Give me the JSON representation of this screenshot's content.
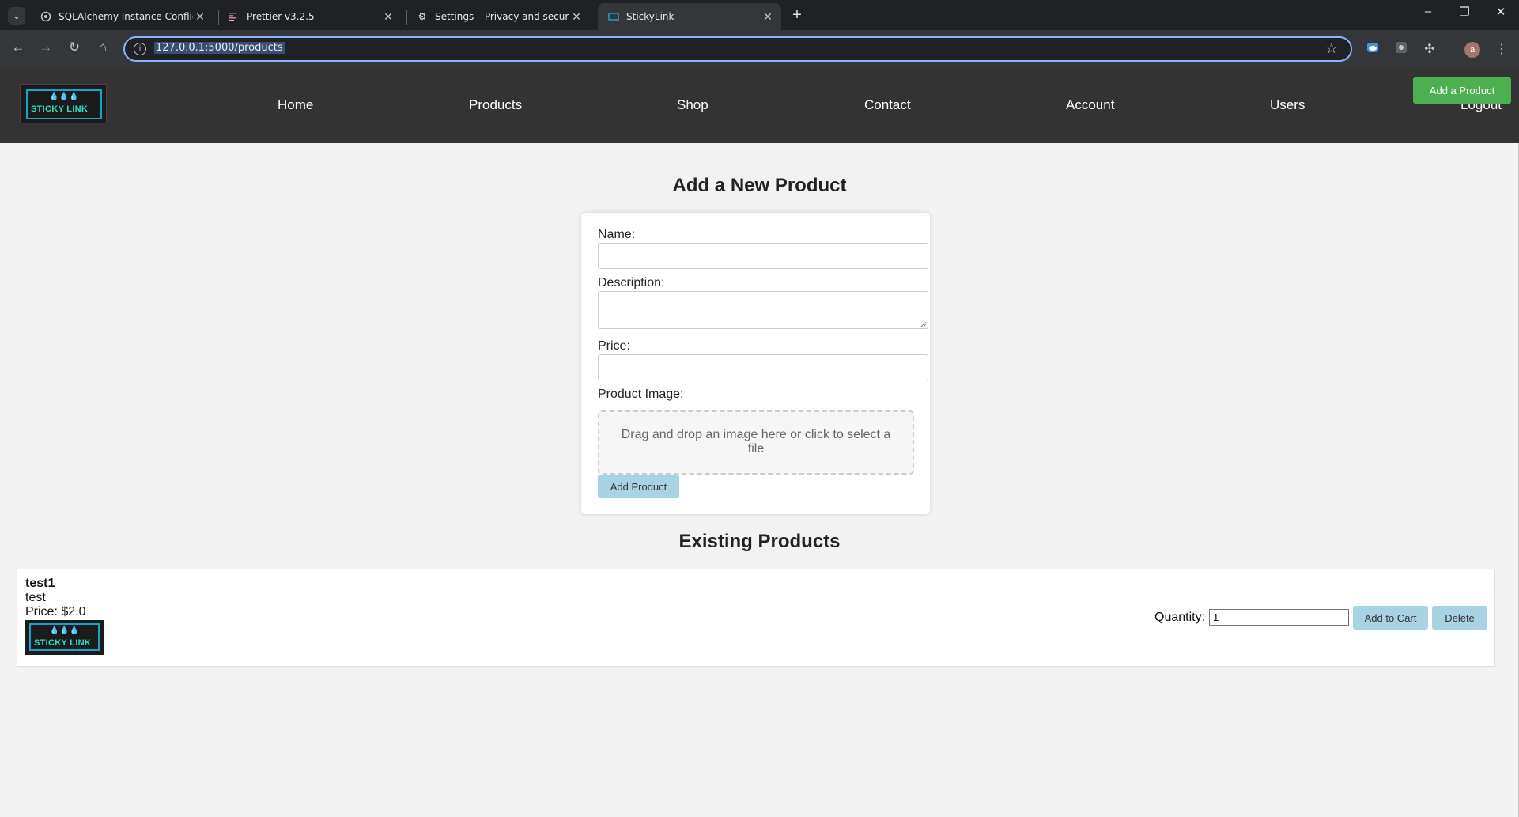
{
  "browser": {
    "tabs": [
      {
        "title": "SQLAlchemy Instance Conflict",
        "icon": "openai-icon"
      },
      {
        "title": "Prettier v3.2.5",
        "icon": "prettier-icon"
      },
      {
        "title": "Settings – Privacy and security",
        "icon": "gear-icon"
      },
      {
        "title": "StickyLink",
        "icon": "site-icon",
        "active": true
      }
    ],
    "url": "127.0.0.1:5000/products",
    "profile_initial": "a"
  },
  "site": {
    "logo_text": "STICKY LINK",
    "logo_drops": "💧💧💧",
    "nav": [
      "Home",
      "Products",
      "Shop",
      "Contact",
      "Account",
      "Users"
    ],
    "logout": "Logout",
    "add_product_button": "Add a Product"
  },
  "form": {
    "heading": "Add a New Product",
    "name_label": "Name:",
    "description_label": "Description:",
    "price_label": "Price:",
    "image_label": "Product Image:",
    "dropzone_text": "Drag and drop an image here or click to select a file",
    "submit_label": "Add Product"
  },
  "existing": {
    "heading": "Existing Products",
    "products": [
      {
        "name": "test1",
        "description": "test",
        "price": "Price: $2.0",
        "quantity_label": "Quantity:",
        "quantity": "1",
        "add_to_cart": "Add to Cart",
        "delete": "Delete"
      }
    ]
  },
  "colors": {
    "accent_green": "#4caf50",
    "button_blue": "#a8d3e2",
    "header_bg": "#333333"
  }
}
